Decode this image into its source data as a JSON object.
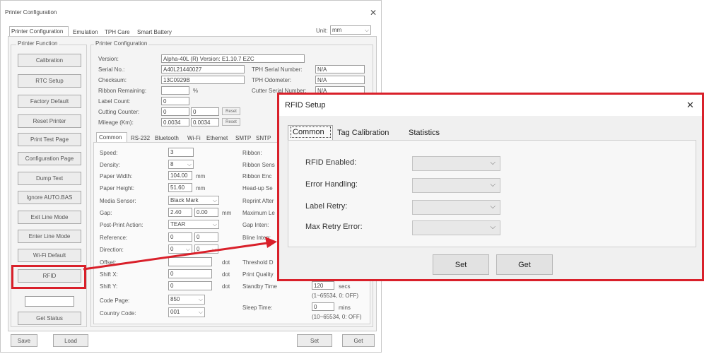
{
  "window": {
    "title": "Printer Configuration",
    "close_label": "✕",
    "tabs": [
      "Printer Configuration",
      "Emulation",
      "TPH Care",
      "Smart Battery"
    ],
    "unit_label": "Unit:",
    "unit_value": "mm"
  },
  "printer_function": {
    "title": "Printer Function",
    "buttons": [
      "Calibration",
      "RTC Setup",
      "Factory Default",
      "Reset Printer",
      "Print Test Page",
      "Configuration Page",
      "Dump Text",
      "Ignore AUTO.BAS",
      "Exit Line Mode",
      "Enter Line Mode",
      "Wi-Fi Default",
      "RFID"
    ],
    "get_status": "Get Status"
  },
  "config": {
    "title": "Printer Configuration",
    "version_label": "Version:",
    "version_value": "Alpha-40L (R) Version: E1.10.7 EZC",
    "serial_label": "Serial No.:",
    "serial_value": "A40L21440027",
    "checksum_label": "Checksum:",
    "checksum_value": "13C0929B",
    "ribbon_label": "Ribbon Remaining:",
    "ribbon_unit": "%",
    "label_count_label": "Label Count:",
    "label_count_value": "0",
    "cutting_label": "Cutting Counter:",
    "cutting_values": [
      "0",
      "0"
    ],
    "mileage_label": "Mileage (Km):",
    "mileage_values": [
      "0.0034",
      "0.0034"
    ],
    "reset_label": "Reset",
    "tph_serial_label": "TPH Serial Number:",
    "tph_serial_value": "N/A",
    "tph_odometer_label": "TPH Odometer:",
    "tph_odometer_value": "N/A",
    "cutter_serial_label": "Cutter Serial Number:",
    "cutter_serial_value": "N/A"
  },
  "subtabs": [
    "Common",
    "RS-232",
    "Bluetooth",
    "Wi-Fi",
    "Ethernet",
    "SMTP",
    "SNTP"
  ],
  "common": {
    "speed_label": "Speed:",
    "speed_value": "3",
    "density_label": "Density:",
    "density_value": "8",
    "paper_width_label": "Paper Width:",
    "paper_width_value": "104.00",
    "paper_width_unit": "mm",
    "paper_height_label": "Paper Height:",
    "paper_height_value": "51.60",
    "paper_height_unit": "mm",
    "media_sensor_label": "Media Sensor:",
    "media_sensor_value": "Black Mark",
    "gap_label": "Gap:",
    "gap_values": [
      "2.40",
      "0.00"
    ],
    "gap_unit": "mm",
    "post_print_label": "Post-Print Action:",
    "post_print_value": "TEAR",
    "reference_label": "Reference:",
    "reference_values": [
      "0",
      "0"
    ],
    "direction_label": "Direction:",
    "direction_values": [
      "0",
      "0"
    ],
    "offset_label": "Offset:",
    "offset_unit": "dot",
    "shift_x_label": "Shift X:",
    "shift_x_value": "0",
    "shift_x_unit": "dot",
    "shift_y_label": "Shift Y:",
    "shift_y_value": "0",
    "shift_y_unit": "dot",
    "code_page_label": "Code Page:",
    "code_page_value": "850",
    "country_code_label": "Country Code:",
    "country_code_value": "001",
    "ribbon_label": "Ribbon:",
    "ribbon_sens_label": "Ribbon Sens",
    "ribbon_enc_label": "Ribbon Enc",
    "headup_label": "Head-up Se",
    "reprint_label": "Reprint After",
    "max_len_label": "Maximum Le",
    "gap_inten_label": "Gap Inten:",
    "bline_inten_label": "Bline Inten:",
    "threshold_label": "Threshold D",
    "print_quality_label": "Print Quality",
    "standby_label": "Standby Time",
    "standby_value": "120",
    "standby_unit": "secs",
    "standby_range": "(1~65534, 0: OFF)",
    "sleep_label": "Sleep Time:",
    "sleep_value": "0",
    "sleep_unit": "mins",
    "sleep_range": "(10~65534, 0: OFF)"
  },
  "footer": {
    "save": "Save",
    "load": "Load",
    "set": "Set",
    "get": "Get"
  },
  "rfid_setup": {
    "title": "RFID Setup",
    "close_label": "✕",
    "tabs": [
      "Common",
      "Tag Calibration",
      "Statistics"
    ],
    "fields": [
      {
        "label": "RFID Enabled:",
        "value": ""
      },
      {
        "label": "Error Handling:",
        "value": ""
      },
      {
        "label": "Label Retry:",
        "value": ""
      },
      {
        "label": "Max Retry Error:",
        "value": ""
      }
    ],
    "set_label": "Set",
    "get_label": "Get"
  },
  "colors": {
    "highlight": "#d9202a",
    "window_bg": "#f0f0f0"
  }
}
